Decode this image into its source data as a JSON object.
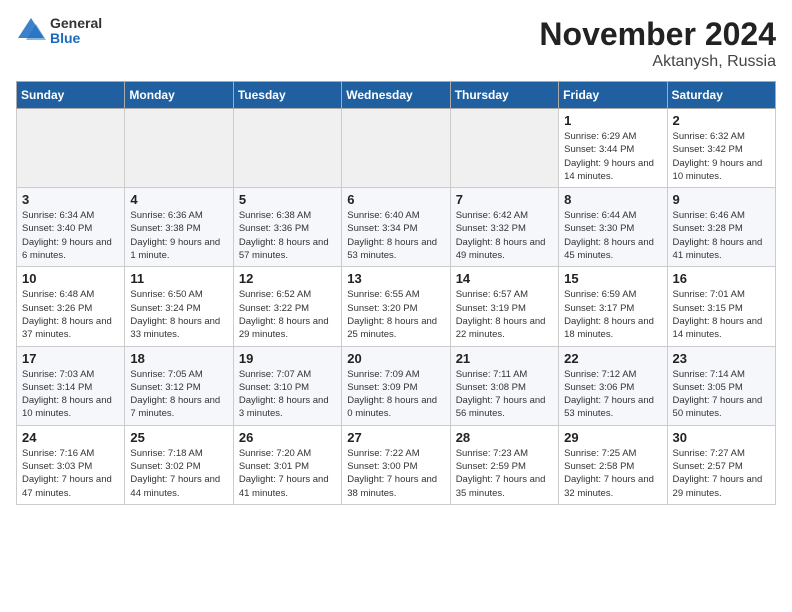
{
  "logo": {
    "general": "General",
    "blue": "Blue"
  },
  "title": "November 2024",
  "subtitle": "Aktanysh, Russia",
  "days_of_week": [
    "Sunday",
    "Monday",
    "Tuesday",
    "Wednesday",
    "Thursday",
    "Friday",
    "Saturday"
  ],
  "weeks": [
    {
      "days": [
        {
          "num": "",
          "info": ""
        },
        {
          "num": "",
          "info": ""
        },
        {
          "num": "",
          "info": ""
        },
        {
          "num": "",
          "info": ""
        },
        {
          "num": "",
          "info": ""
        },
        {
          "num": "1",
          "info": "Sunrise: 6:29 AM\nSunset: 3:44 PM\nDaylight: 9 hours and 14 minutes."
        },
        {
          "num": "2",
          "info": "Sunrise: 6:32 AM\nSunset: 3:42 PM\nDaylight: 9 hours and 10 minutes."
        }
      ]
    },
    {
      "days": [
        {
          "num": "3",
          "info": "Sunrise: 6:34 AM\nSunset: 3:40 PM\nDaylight: 9 hours and 6 minutes."
        },
        {
          "num": "4",
          "info": "Sunrise: 6:36 AM\nSunset: 3:38 PM\nDaylight: 9 hours and 1 minute."
        },
        {
          "num": "5",
          "info": "Sunrise: 6:38 AM\nSunset: 3:36 PM\nDaylight: 8 hours and 57 minutes."
        },
        {
          "num": "6",
          "info": "Sunrise: 6:40 AM\nSunset: 3:34 PM\nDaylight: 8 hours and 53 minutes."
        },
        {
          "num": "7",
          "info": "Sunrise: 6:42 AM\nSunset: 3:32 PM\nDaylight: 8 hours and 49 minutes."
        },
        {
          "num": "8",
          "info": "Sunrise: 6:44 AM\nSunset: 3:30 PM\nDaylight: 8 hours and 45 minutes."
        },
        {
          "num": "9",
          "info": "Sunrise: 6:46 AM\nSunset: 3:28 PM\nDaylight: 8 hours and 41 minutes."
        }
      ]
    },
    {
      "days": [
        {
          "num": "10",
          "info": "Sunrise: 6:48 AM\nSunset: 3:26 PM\nDaylight: 8 hours and 37 minutes."
        },
        {
          "num": "11",
          "info": "Sunrise: 6:50 AM\nSunset: 3:24 PM\nDaylight: 8 hours and 33 minutes."
        },
        {
          "num": "12",
          "info": "Sunrise: 6:52 AM\nSunset: 3:22 PM\nDaylight: 8 hours and 29 minutes."
        },
        {
          "num": "13",
          "info": "Sunrise: 6:55 AM\nSunset: 3:20 PM\nDaylight: 8 hours and 25 minutes."
        },
        {
          "num": "14",
          "info": "Sunrise: 6:57 AM\nSunset: 3:19 PM\nDaylight: 8 hours and 22 minutes."
        },
        {
          "num": "15",
          "info": "Sunrise: 6:59 AM\nSunset: 3:17 PM\nDaylight: 8 hours and 18 minutes."
        },
        {
          "num": "16",
          "info": "Sunrise: 7:01 AM\nSunset: 3:15 PM\nDaylight: 8 hours and 14 minutes."
        }
      ]
    },
    {
      "days": [
        {
          "num": "17",
          "info": "Sunrise: 7:03 AM\nSunset: 3:14 PM\nDaylight: 8 hours and 10 minutes."
        },
        {
          "num": "18",
          "info": "Sunrise: 7:05 AM\nSunset: 3:12 PM\nDaylight: 8 hours and 7 minutes."
        },
        {
          "num": "19",
          "info": "Sunrise: 7:07 AM\nSunset: 3:10 PM\nDaylight: 8 hours and 3 minutes."
        },
        {
          "num": "20",
          "info": "Sunrise: 7:09 AM\nSunset: 3:09 PM\nDaylight: 8 hours and 0 minutes."
        },
        {
          "num": "21",
          "info": "Sunrise: 7:11 AM\nSunset: 3:08 PM\nDaylight: 7 hours and 56 minutes."
        },
        {
          "num": "22",
          "info": "Sunrise: 7:12 AM\nSunset: 3:06 PM\nDaylight: 7 hours and 53 minutes."
        },
        {
          "num": "23",
          "info": "Sunrise: 7:14 AM\nSunset: 3:05 PM\nDaylight: 7 hours and 50 minutes."
        }
      ]
    },
    {
      "days": [
        {
          "num": "24",
          "info": "Sunrise: 7:16 AM\nSunset: 3:03 PM\nDaylight: 7 hours and 47 minutes."
        },
        {
          "num": "25",
          "info": "Sunrise: 7:18 AM\nSunset: 3:02 PM\nDaylight: 7 hours and 44 minutes."
        },
        {
          "num": "26",
          "info": "Sunrise: 7:20 AM\nSunset: 3:01 PM\nDaylight: 7 hours and 41 minutes."
        },
        {
          "num": "27",
          "info": "Sunrise: 7:22 AM\nSunset: 3:00 PM\nDaylight: 7 hours and 38 minutes."
        },
        {
          "num": "28",
          "info": "Sunrise: 7:23 AM\nSunset: 2:59 PM\nDaylight: 7 hours and 35 minutes."
        },
        {
          "num": "29",
          "info": "Sunrise: 7:25 AM\nSunset: 2:58 PM\nDaylight: 7 hours and 32 minutes."
        },
        {
          "num": "30",
          "info": "Sunrise: 7:27 AM\nSunset: 2:57 PM\nDaylight: 7 hours and 29 minutes."
        }
      ]
    }
  ]
}
